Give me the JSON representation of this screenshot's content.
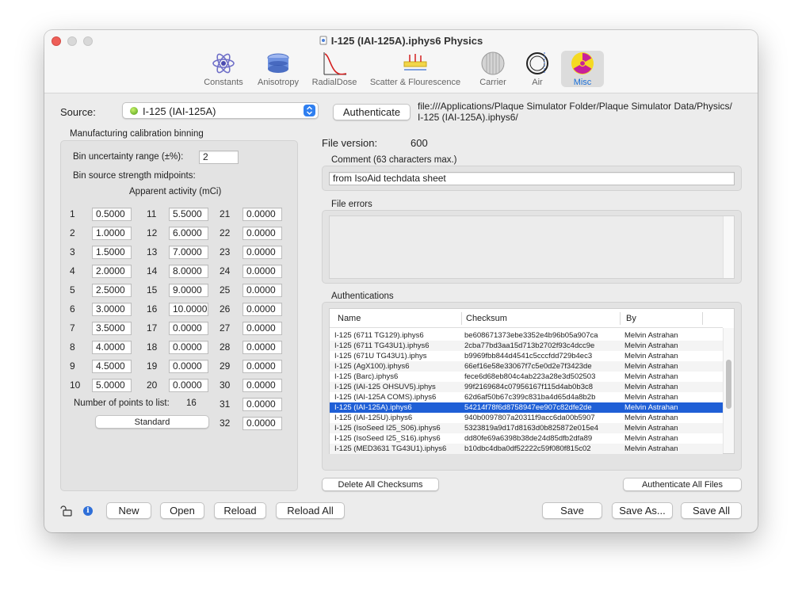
{
  "window": {
    "title": "I-125 (IAI-125A).iphys6 Physics"
  },
  "toolbar": [
    {
      "label": "Constants",
      "icon": "atom-icon"
    },
    {
      "label": "Anisotropy",
      "icon": "anisotropy-icon"
    },
    {
      "label": "RadialDose",
      "icon": "radial-dose-icon"
    },
    {
      "label": "Scatter & Flourescence",
      "icon": "scatter-icon"
    },
    {
      "label": "Carrier",
      "icon": "carrier-icon"
    },
    {
      "label": "Air",
      "icon": "air-icon"
    },
    {
      "label": "Misc",
      "icon": "radiation-icon",
      "selected": true
    }
  ],
  "source": {
    "label": "Source:",
    "value": "I-125 (IAI-125A)",
    "authenticate_label": "Authenticate",
    "path_line1": "file:///Applications/Plaque Simulator Folder/Plaque Simulator Data/Physics/",
    "path_line2": "I-125 (IAI-125A).iphys6/"
  },
  "calibration": {
    "title": "Manufacturing calibration binning",
    "uncertainty_label": "Bin uncertainty range (±%):",
    "uncertainty_value": "2",
    "midpoints_label": "Bin source strength midpoints:",
    "activity_label": "Apparent activity (mCi)",
    "bins": [
      {
        "n": "1",
        "v": "0.5000"
      },
      {
        "n": "2",
        "v": "1.0000"
      },
      {
        "n": "3",
        "v": "1.5000"
      },
      {
        "n": "4",
        "v": "2.0000"
      },
      {
        "n": "5",
        "v": "2.5000"
      },
      {
        "n": "6",
        "v": "3.0000"
      },
      {
        "n": "7",
        "v": "3.5000"
      },
      {
        "n": "8",
        "v": "4.0000"
      },
      {
        "n": "9",
        "v": "4.5000"
      },
      {
        "n": "10",
        "v": "5.0000"
      },
      {
        "n": "11",
        "v": "5.5000"
      },
      {
        "n": "12",
        "v": "6.0000"
      },
      {
        "n": "13",
        "v": "7.0000"
      },
      {
        "n": "14",
        "v": "8.0000"
      },
      {
        "n": "15",
        "v": "9.0000"
      },
      {
        "n": "16",
        "v": "10.0000"
      },
      {
        "n": "17",
        "v": "0.0000"
      },
      {
        "n": "18",
        "v": "0.0000"
      },
      {
        "n": "19",
        "v": "0.0000"
      },
      {
        "n": "20",
        "v": "0.0000"
      },
      {
        "n": "21",
        "v": "0.0000"
      },
      {
        "n": "22",
        "v": "0.0000"
      },
      {
        "n": "23",
        "v": "0.0000"
      },
      {
        "n": "24",
        "v": "0.0000"
      },
      {
        "n": "25",
        "v": "0.0000"
      },
      {
        "n": "26",
        "v": "0.0000"
      },
      {
        "n": "27",
        "v": "0.0000"
      },
      {
        "n": "28",
        "v": "0.0000"
      },
      {
        "n": "29",
        "v": "0.0000"
      },
      {
        "n": "30",
        "v": "0.0000"
      },
      {
        "n": "31",
        "v": "0.0000"
      },
      {
        "n": "32",
        "v": "0.0000"
      }
    ],
    "points_label": "Number of points to list:",
    "points_value": "16",
    "standard_label": "Standard"
  },
  "file": {
    "version_label": "File version:",
    "version_value": "600",
    "comment_label": "Comment (63 characters max.)",
    "comment_value": "from IsoAid techdata sheet",
    "errors_label": "File errors"
  },
  "auth": {
    "title": "Authentications",
    "columns": [
      "Name",
      "Checksum",
      "By"
    ],
    "rows": [
      {
        "name": "I-125 (6711 TG129).iphys6",
        "checksum": "be608671373ebe3352e4b96b05a907ca",
        "by": "Melvin Astrahan"
      },
      {
        "name": "I-125 (6711 TG43U1).iphys6",
        "checksum": "2cba77bd3aa15d713b2702f93c4dcc9e",
        "by": "Melvin Astrahan"
      },
      {
        "name": "I-125 (671U TG43U1).iphys",
        "checksum": "b9969fbb844d4541c5cccfdd729b4ec3",
        "by": "Melvin Astrahan"
      },
      {
        "name": "I-125 (AgX100).iphys6",
        "checksum": "66ef16e58e33067f7c5e0d2e7f3423de",
        "by": "Melvin Astrahan"
      },
      {
        "name": "I-125 (Barc).iphys6",
        "checksum": "fece6d68eb804c4ab223a28e3d502503",
        "by": "Melvin Astrahan"
      },
      {
        "name": "I-125 (IAI-125 OHSUV5).iphys",
        "checksum": "99f2169684c07956167f115d4ab0b3c8",
        "by": "Melvin Astrahan"
      },
      {
        "name": "I-125 (IAI-125A COMS).iphys6",
        "checksum": "62d6af50b67c399c831ba4d65d4a8b2b",
        "by": "Melvin Astrahan"
      },
      {
        "name": "I-125 (IAI-125A).iphys6",
        "checksum": "54214f78f6d8758947ee907c82dfe2de",
        "by": "Melvin Astrahan",
        "selected": true
      },
      {
        "name": "I-125 (IAI-125U).iphys6",
        "checksum": "940b0097807a20311f9acc6da00b5907",
        "by": "Melvin Astrahan"
      },
      {
        "name": "I-125 (IsoSeed I25_S06).iphys6",
        "checksum": "5323819a9d17d8163d0b825872e015e4",
        "by": "Melvin Astrahan"
      },
      {
        "name": "I-125 (IsoSeed I25_S16).iphys6",
        "checksum": "dd80fe69a6398b38de24d85dfb2dfa89",
        "by": "Melvin Astrahan"
      },
      {
        "name": "I-125 (MED3631 TG43U1).iphys6",
        "checksum": "b10dbc4dba0df52222c59f080f815c02",
        "by": "Melvin Astrahan"
      }
    ],
    "delete_label": "Delete All Checksums",
    "authenticate_all_label": "Authenticate All Files"
  },
  "bottom": {
    "new_label": "New",
    "open_label": "Open",
    "reload_label": "Reload",
    "reload_all_label": "Reload All",
    "save_label": "Save",
    "save_as_label": "Save As...",
    "save_all_label": "Save All"
  },
  "colors": {
    "accent": "#1f5fd6",
    "close": "#ee5f58"
  }
}
